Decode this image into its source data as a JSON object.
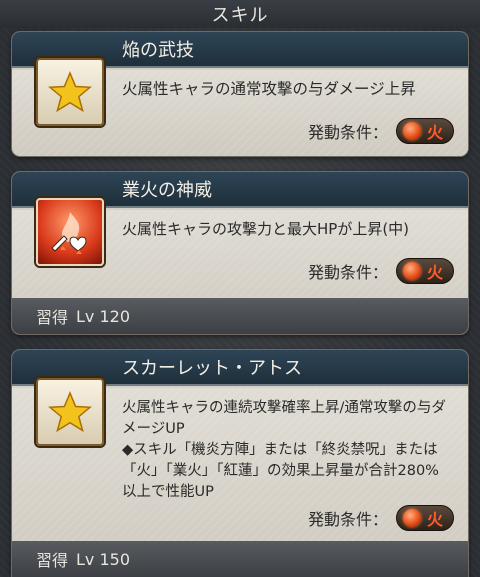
{
  "header": {
    "title": "スキル"
  },
  "skills": [
    {
      "name": "焔の武技",
      "icon": "star-icon",
      "description": "火属性キャラの通常攻撃の与ダメージ上昇",
      "condition_label": "発動条件：",
      "condition_element": "火"
    },
    {
      "name": "業火の神威",
      "icon": "fire-attack-hp-up-icon",
      "description": "火属性キャラの攻撃力と最大HPが上昇(中)",
      "condition_label": "発動条件：",
      "condition_element": "火",
      "acquire_label": "習得",
      "acquire_level": "Lv 120"
    },
    {
      "name": "スカーレット・アトス",
      "icon": "star-icon",
      "description_line1": "火属性キャラの連続攻撃確率上昇/通常攻撃の与ダメージUP",
      "description_line2": "◆スキル「機炎方陣」または「終炎禁呪」または「火」「業火」「紅蓮」の効果上昇量が合計280%以上で性能UP",
      "condition_label": "発動条件：",
      "condition_element": "火",
      "acquire_label": "習得",
      "acquire_level": "Lv 150"
    }
  ],
  "colors": {
    "fire": "#e8501a",
    "title_bar": "#2e4556"
  }
}
